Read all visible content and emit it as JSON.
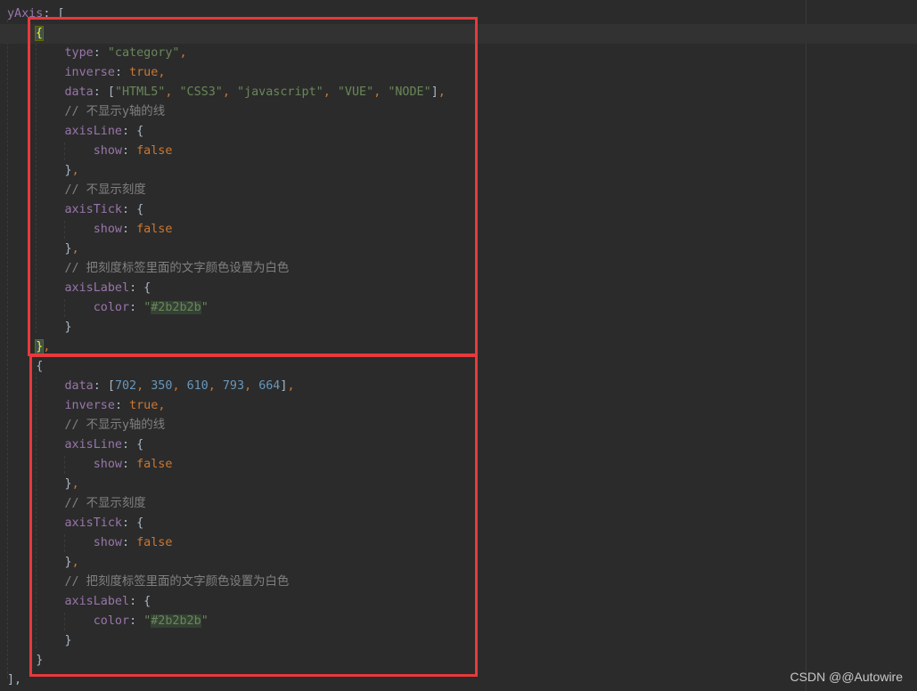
{
  "code": {
    "l0": "yAxis",
    "l0_rest": ": [",
    "open_brace": "{",
    "type_key": "type",
    "type_val": "\"category\"",
    "inverse_key": "inverse",
    "true_val": "true",
    "data_key": "data",
    "data_vals": [
      "\"HTML5\"",
      "\"CSS3\"",
      "\"javascript\"",
      "\"VUE\"",
      "\"NODE\""
    ],
    "comment_line": "// 不显示y轴的线",
    "axisLine_key": "axisLine",
    "show_key": "show",
    "false_val": "false",
    "comment_tick": "// 不显示刻度",
    "axisTick_key": "axisTick",
    "comment_label": "// 把刻度标签里面的文字颜色设置为白色",
    "axisLabel_key": "axisLabel",
    "color_key": "color",
    "color_val": "#2b2b2b",
    "num_vals": [
      "702",
      "350",
      "610",
      "793",
      "664"
    ],
    "close_array": "],"
  },
  "watermark": "CSDN @@Autowire",
  "colors": {
    "background": "#2b2b2b",
    "highlight_box": "#e8393b",
    "keyword": "#cc7832",
    "string": "#6a8759",
    "property": "#9876aa",
    "number": "#6897bb",
    "comment": "#808080"
  }
}
